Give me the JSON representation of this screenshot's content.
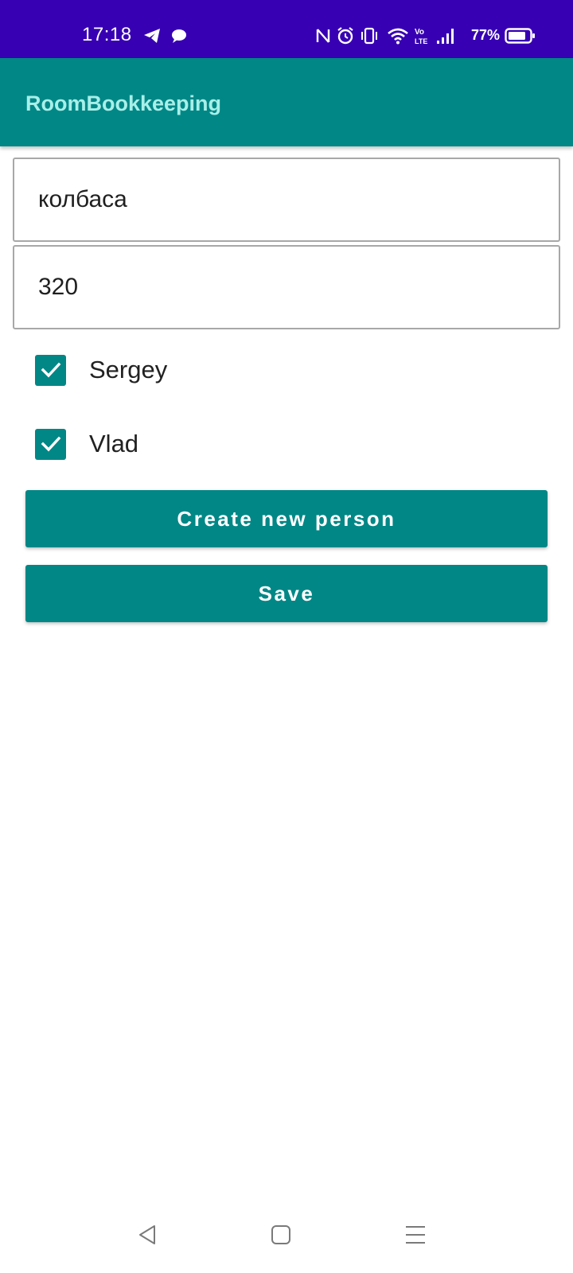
{
  "status_bar": {
    "time": "17:18",
    "battery_percent": "77%",
    "icons": [
      "telegram-icon",
      "chat-bubble-icon",
      "nfc-icon",
      "alarm-icon",
      "vibrate-icon",
      "wifi-icon",
      "volte-icon",
      "signal-icon",
      "battery-icon"
    ],
    "background_color": "#3700b3"
  },
  "app_bar": {
    "title": "RoomBookkeeping",
    "background_color": "#018786",
    "title_color": "#a8efe9"
  },
  "form": {
    "name_field": {
      "value": "колбаса"
    },
    "amount_field": {
      "value": "320"
    },
    "persons": [
      {
        "label": "Sergey",
        "checked": true
      },
      {
        "label": "Vlad",
        "checked": true
      }
    ],
    "create_person_button": "Create new person",
    "save_button": "Save",
    "accent_color": "#018786"
  },
  "nav_bar": {
    "icons": [
      "back-icon",
      "home-icon",
      "recents-icon"
    ]
  }
}
